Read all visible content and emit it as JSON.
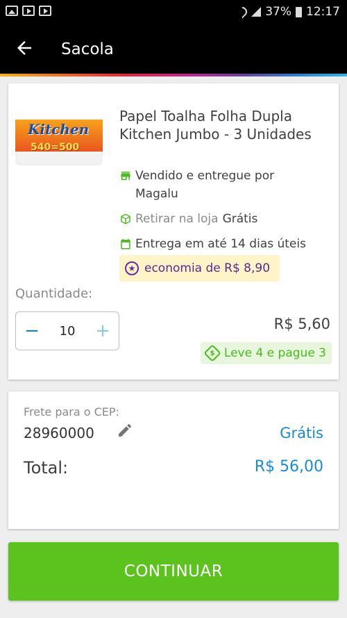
{
  "status_bar": {
    "battery": "37%",
    "time": "12:17"
  },
  "app_bar": {
    "title": "Sacola",
    "back_icon": "arrow-left-icon"
  },
  "product": {
    "name": "Papel Toalha Folha Dupla Kitchen Jumbo - 3 Unidades",
    "image_brand": "Kitchen",
    "image_sub": "540=500",
    "seller_line": "Vendido e entregue por Magalu",
    "pickup_label": "Retirar na loja",
    "pickup_value": "Grátis",
    "delivery_line": "Entrega em até 14 dias úteis",
    "economy_badge": "economia de R$ 8,90",
    "quantity_label": "Quantidade:",
    "quantity_value": "10",
    "unit_price": "R$ 5,60",
    "promo_badge": "Leve 4 e pague 3",
    "promo_symbol": "$"
  },
  "shipping": {
    "cep_label": "Frete para o CEP:",
    "cep_value": "28960000",
    "price": "Grátis"
  },
  "total": {
    "label": "Total:",
    "value": "R$ 56,00"
  },
  "actions": {
    "continue_label": "CONTINUAR"
  },
  "colors": {
    "primary_blue": "#1b8ad6",
    "green": "#5cc21d",
    "economy_purple": "#5b2a8c",
    "economy_bg": "#fff3c8"
  }
}
